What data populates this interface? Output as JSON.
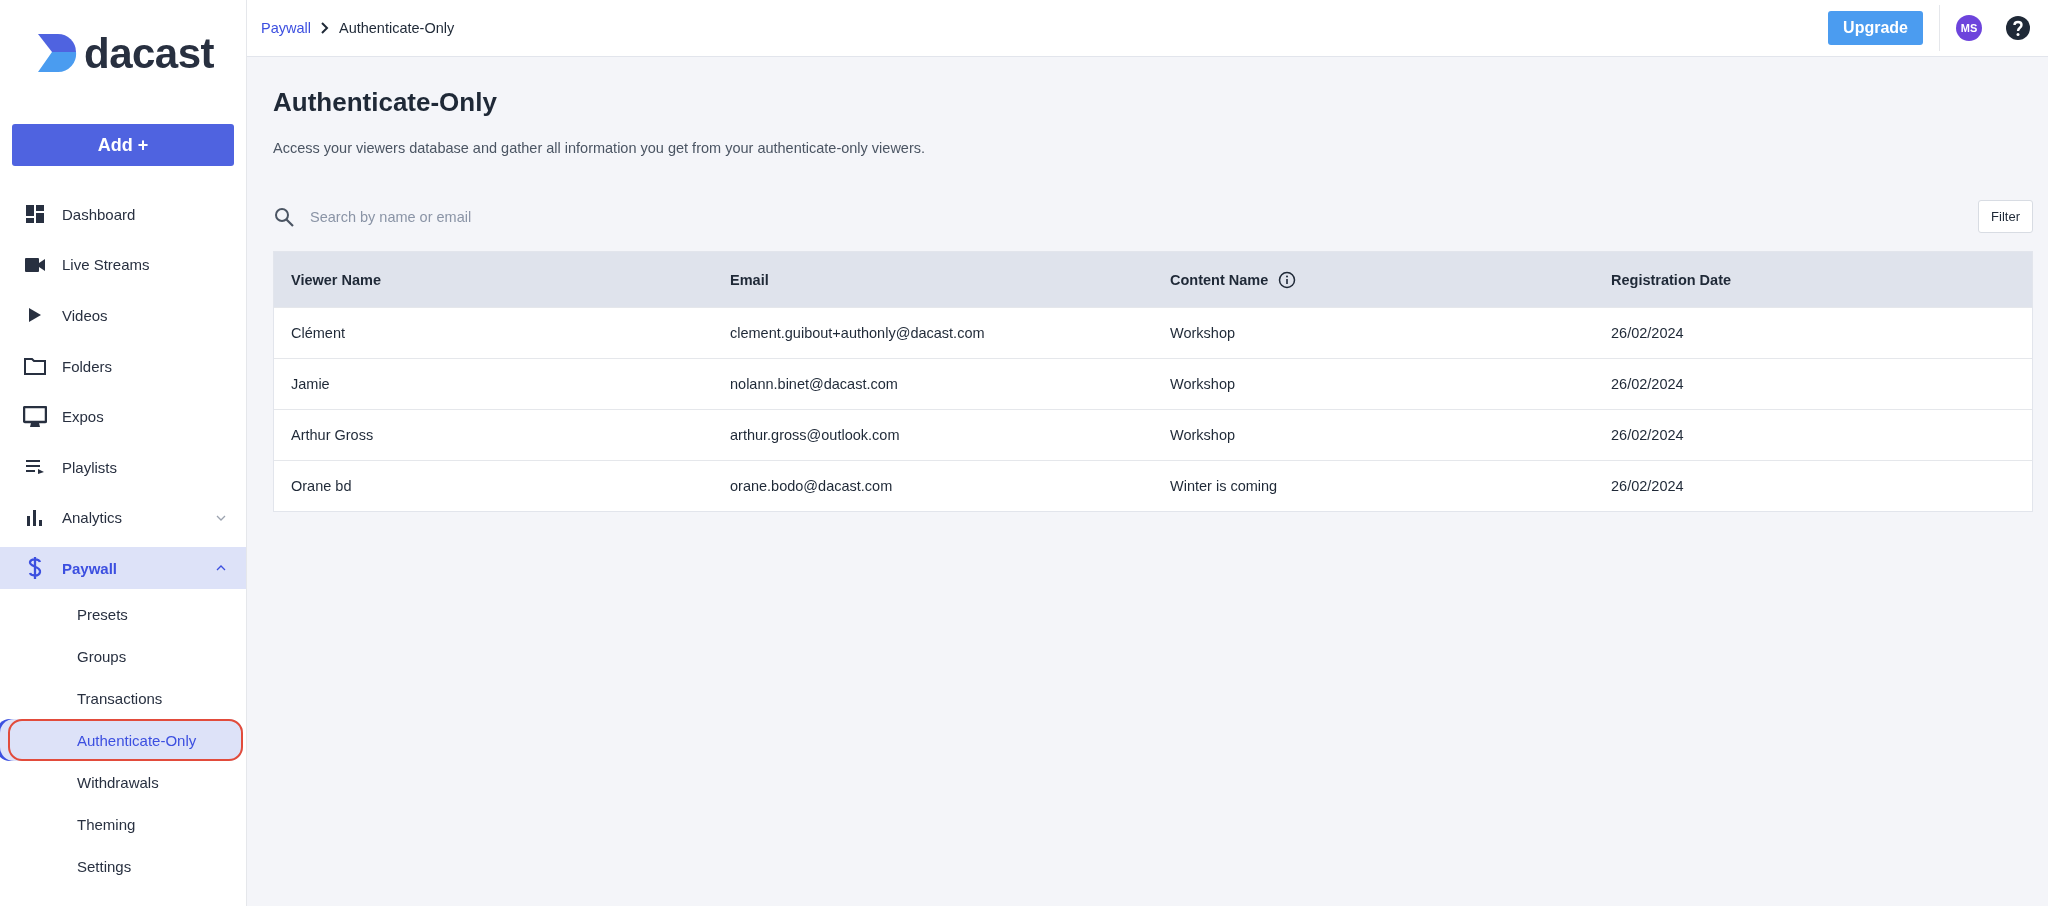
{
  "sidebar": {
    "logo": "dacast",
    "add_button": "Add +",
    "items": [
      {
        "label": "Dashboard",
        "kind": "dashboard",
        "selected": false
      },
      {
        "label": "Live Streams",
        "kind": "camera",
        "selected": false
      },
      {
        "label": "Videos",
        "kind": "play",
        "selected": false
      },
      {
        "label": "Folders",
        "kind": "folder",
        "selected": false
      },
      {
        "label": "Expos",
        "kind": "monitor",
        "selected": false
      },
      {
        "label": "Playlists",
        "kind": "playlist",
        "selected": false
      },
      {
        "label": "Analytics",
        "kind": "chart",
        "selected": false,
        "expanded": false
      },
      {
        "label": "Paywall",
        "kind": "dollar",
        "selected": true,
        "expanded": true,
        "children": [
          {
            "label": "Presets",
            "selected": false,
            "circled": false
          },
          {
            "label": "Groups",
            "selected": false,
            "circled": false
          },
          {
            "label": "Transactions",
            "selected": false,
            "circled": false
          },
          {
            "label": "Authenticate-Only",
            "selected": true,
            "circled": true
          },
          {
            "label": "Withdrawals",
            "selected": false,
            "circled": false
          },
          {
            "label": "Theming",
            "selected": false,
            "circled": false
          },
          {
            "label": "Settings",
            "selected": false,
            "circled": false
          }
        ]
      }
    ]
  },
  "header": {
    "breadcrumb": [
      "Paywall",
      "Authenticate-Only"
    ],
    "upgrade_button": "Upgrade",
    "avatar": "MS"
  },
  "page": {
    "title": "Authenticate-Only",
    "description": "Access your viewers database and gather all information you get from your authenticate-only viewers.",
    "search": {
      "placeholder": "Search by name or email"
    },
    "filter_button": "Filter"
  },
  "table": {
    "columns": [
      {
        "label": "Viewer Name",
        "info": false
      },
      {
        "label": "Email",
        "info": false
      },
      {
        "label": "Content Name",
        "info": true
      },
      {
        "label": "Registration Date",
        "info": false
      }
    ],
    "rows": [
      [
        "Clément",
        "clement.guibout+authonly@dacast.com",
        "Workshop",
        "26/02/2024"
      ],
      [
        "Jamie",
        "nolann.binet@dacast.com",
        "Workshop",
        "26/02/2024"
      ],
      [
        "Arthur Gross",
        "arthur.gross@outlook.com",
        "Workshop",
        "26/02/2024"
      ],
      [
        "Orane bd",
        "orane.bodo@dacast.com",
        "Winter is coming",
        "26/02/2024"
      ]
    ]
  }
}
